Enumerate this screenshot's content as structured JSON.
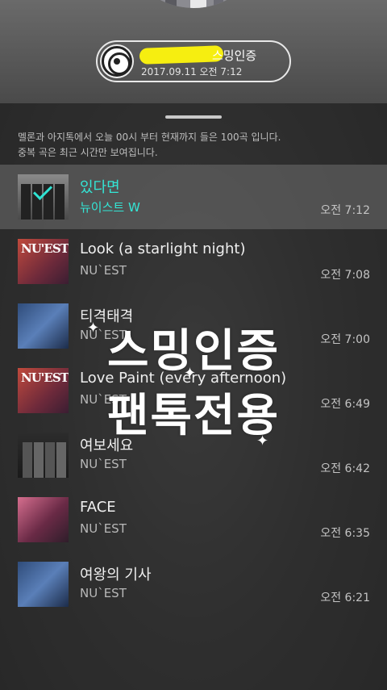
{
  "header": {
    "cert_title": "스밍인증",
    "cert_time": "2017.09.11 오전 7:12"
  },
  "notice": {
    "line1": "멜론과 아지톡에서 오늘 00시 부터 현재까지 들은 100곡 입니다.",
    "line2": "중복 곡은 최근 시간만 보여집니다."
  },
  "songs": [
    {
      "title": "있다면",
      "artist": "뉴이스트 W",
      "time": "오전 7:12",
      "active": true
    },
    {
      "title": "Look (a starlight night)",
      "artist": "NU`EST",
      "time": "오전 7:08"
    },
    {
      "title": "티격태격",
      "artist": "NU`EST",
      "time": "오전 7:00"
    },
    {
      "title": "Love Paint (every afternoon)",
      "artist": "NU`EST",
      "time": "오전 6:49"
    },
    {
      "title": "여보세요",
      "artist": "NU`EST",
      "time": "오전 6:42"
    },
    {
      "title": "FACE",
      "artist": "NU`EST",
      "time": "오전 6:35"
    },
    {
      "title": "여왕의 기사",
      "artist": "NU`EST",
      "time": "오전 6:21"
    }
  ],
  "overlay": {
    "line1": "스밍인증",
    "line2": "팬톡전용"
  },
  "album_text": {
    "look": "NU'EST",
    "love_paint": "NU'EST"
  },
  "colors": {
    "accent": "#33e6d6",
    "redaction": "#f6ee10"
  }
}
